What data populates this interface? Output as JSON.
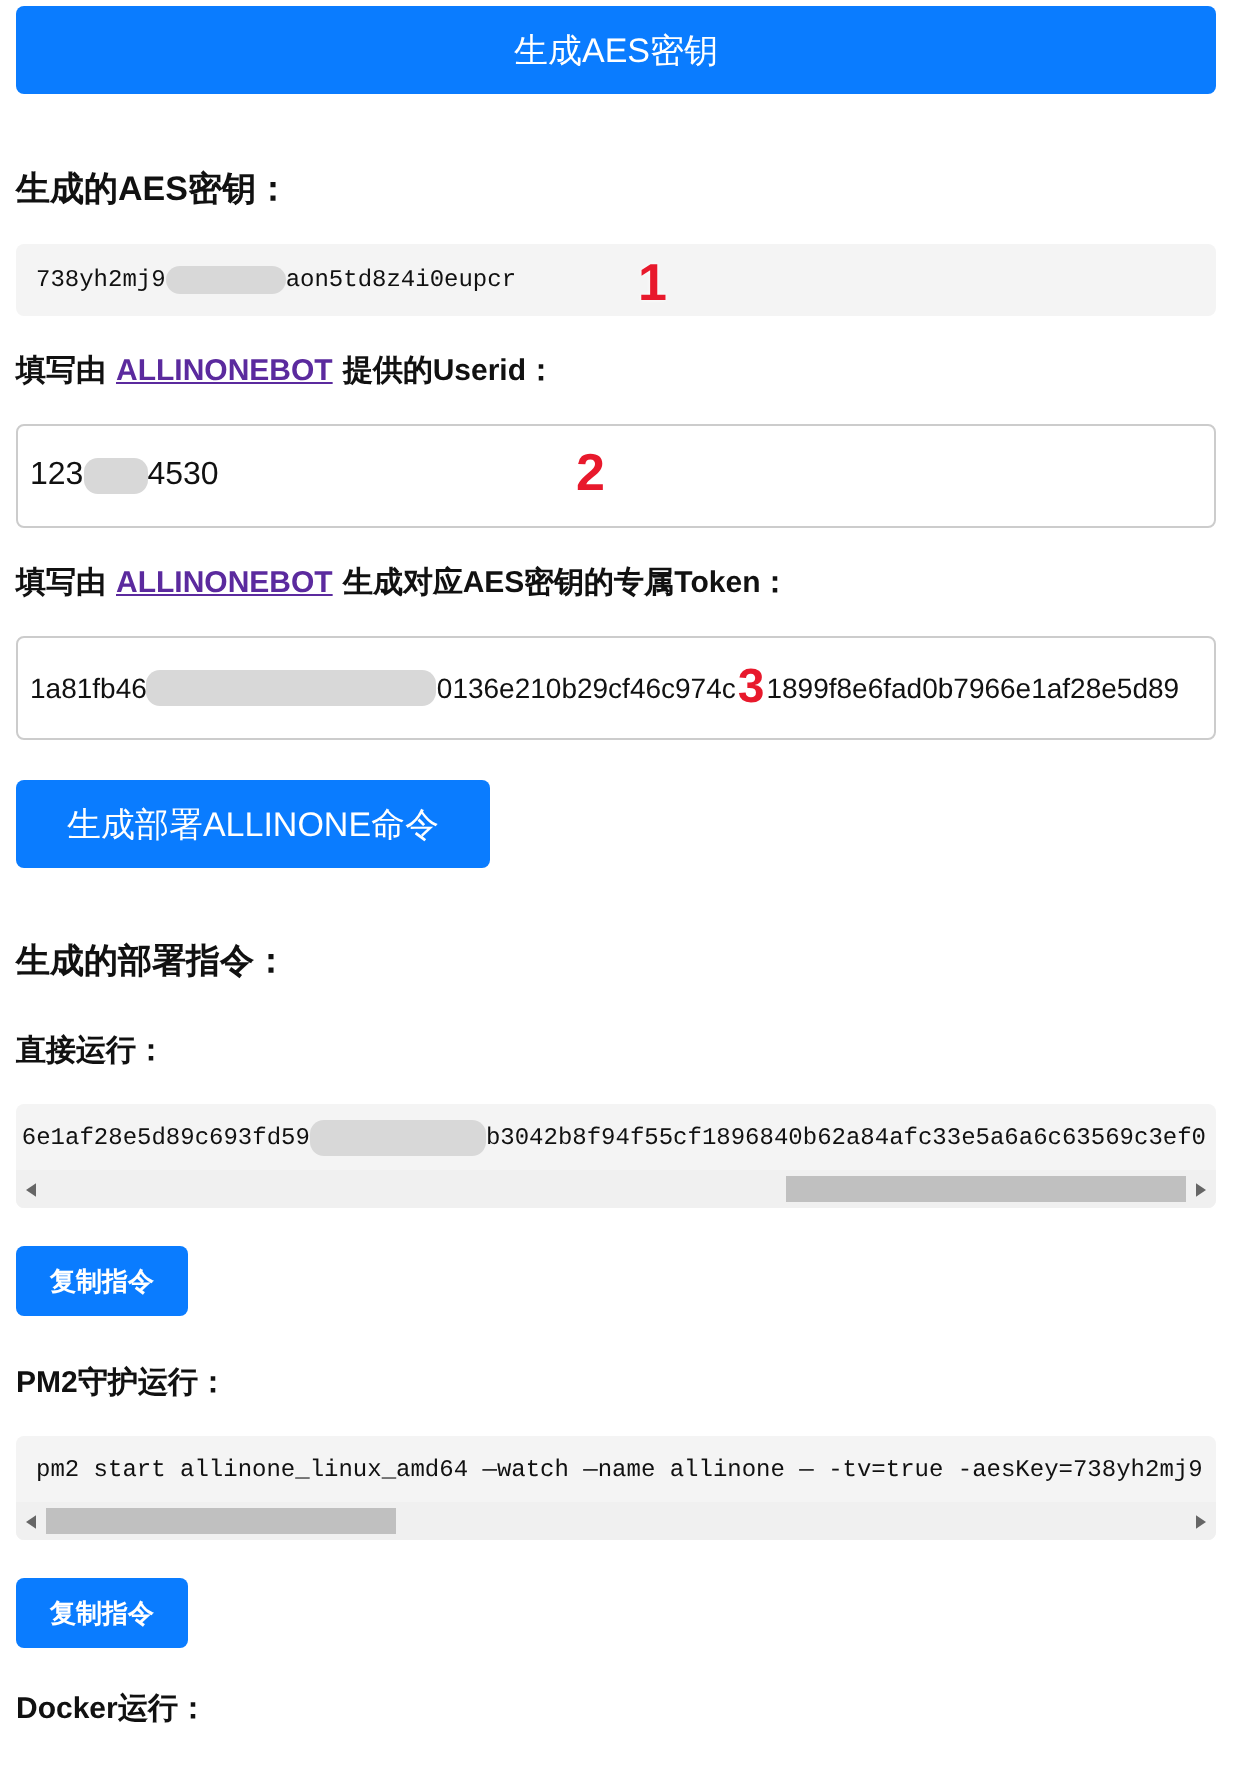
{
  "generate_key_button": "生成AES密钥",
  "key_section": {
    "heading": "生成的AES密钥：",
    "key_start": "738yh2mj9",
    "key_end": "aon5td8z4i0eupcr",
    "marker": "1"
  },
  "userid_section": {
    "label_before": "填写由",
    "link": "ALLINONEBOT",
    "label_after": "提供的Userid：",
    "value_start": "123",
    "value_end": "4530",
    "marker": "2"
  },
  "token_section": {
    "label_before": "填写由",
    "link": "ALLINONEBOT",
    "label_after": "生成对应AES密钥的专属Token：",
    "value_start": "1a81fb46",
    "value_end": "0136e210b29cf46c974c",
    "marker": "3",
    "value_tail": "1899f8e6fad0b7966e1af28e5d89"
  },
  "deploy_button": "生成部署ALLINONE命令",
  "commands_heading": "生成的部署指令：",
  "commands": [
    {
      "label": "直接运行：",
      "text_start": "6e1af28e5d89c693fd59",
      "text_end": "b3042b8f94f55cf1896840b62a84afc33e5a6a6c63569c3ef0",
      "kind": "scrolled-right",
      "copy_button": "复制指令"
    },
    {
      "label": "PM2守护运行：",
      "text_start": "pm2 start allinone_linux_amd64 —watch —name allinone — -tv=true -aesKey=738yh2mj9",
      "kind": "scrolled-left",
      "copy_button": "复制指令"
    }
  ],
  "last_label": "Docker运行："
}
